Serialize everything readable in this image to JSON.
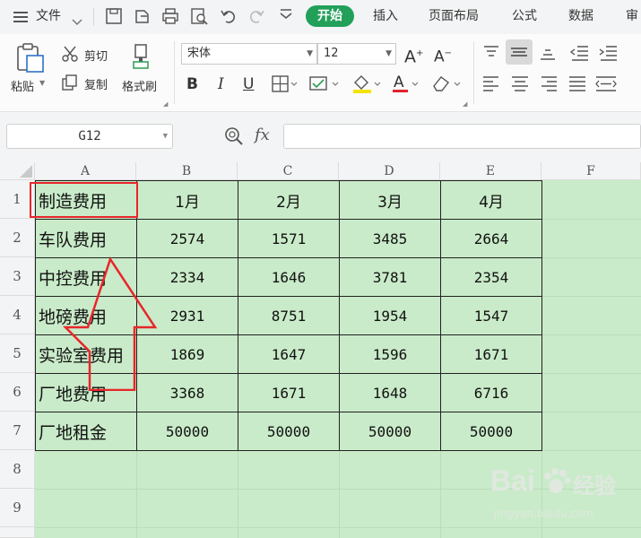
{
  "menubar": {
    "file_label": "文件",
    "tabs": [
      "开始",
      "插入",
      "页面布局",
      "公式",
      "数据",
      "审"
    ]
  },
  "ribbon": {
    "paste_label": "粘贴",
    "cut_label": "剪切",
    "copy_label": "复制",
    "format_painter_label": "格式刷",
    "font_name": "宋体",
    "font_size": "12"
  },
  "formula_bar": {
    "name_box": "G12",
    "fx_label": "fx",
    "formula": ""
  },
  "sheet": {
    "columns": [
      "A",
      "B",
      "C",
      "D",
      "E",
      "F"
    ],
    "rows": [
      "1",
      "2",
      "3",
      "4",
      "5",
      "6",
      "7",
      "8",
      "9"
    ],
    "table": [
      [
        "制造费用",
        "1月",
        "2月",
        "3月",
        "4月"
      ],
      [
        "车队费用",
        "2574",
        "1571",
        "3485",
        "2664"
      ],
      [
        "中控费用",
        "2334",
        "1646",
        "3781",
        "2354"
      ],
      [
        "地磅费用",
        "2931",
        "8751",
        "1954",
        "1547"
      ],
      [
        "实验室费用",
        "1869",
        "1647",
        "1596",
        "1671"
      ],
      [
        "厂地费用",
        "3368",
        "1671",
        "1648",
        "6716"
      ],
      [
        "厂地租金",
        "50000",
        "50000",
        "50000",
        "50000"
      ]
    ]
  },
  "watermark": {
    "brand": "Bai",
    "brand2": "经验",
    "url": "jingyan.baidu.com"
  },
  "colors": {
    "accent": "#22a05a",
    "sheet_bg": "#c9ebc9",
    "annotation": "#e8262a"
  }
}
